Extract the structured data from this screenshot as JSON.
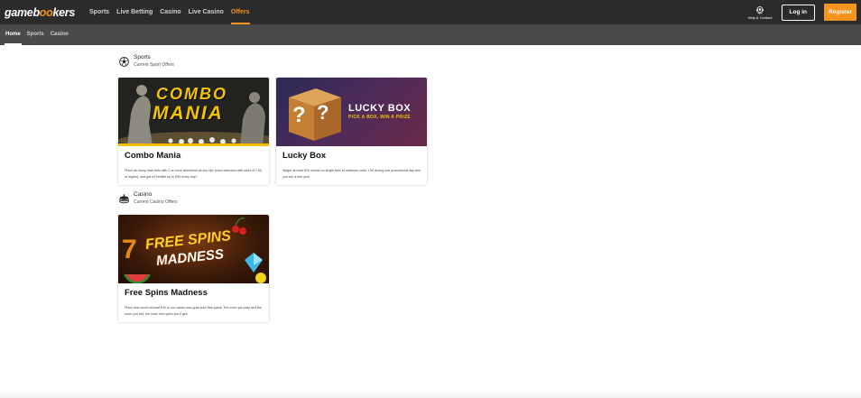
{
  "header": {
    "logo_prefix": "gameb",
    "logo_accent": "oo",
    "logo_suffix": "kers",
    "nav": [
      {
        "label": "Sports",
        "active": false
      },
      {
        "label": "Live Betting",
        "active": false
      },
      {
        "label": "Casino",
        "active": false
      },
      {
        "label": "Live Casino",
        "active": false
      },
      {
        "label": "Offers",
        "active": true
      }
    ],
    "help_label": "Help & Contact",
    "help_icon": "headset-icon",
    "login_label": "Log in",
    "register_label": "Register"
  },
  "subnav": [
    {
      "label": "Home",
      "active": true
    },
    {
      "label": "Sports",
      "active": false
    },
    {
      "label": "Casino",
      "active": false
    }
  ],
  "sections": {
    "sports": {
      "title": "Sports",
      "subtitle": "Current Sport Offers",
      "icon": "soccer-ball-icon",
      "cards": [
        {
          "title": "Combo Mania",
          "banner_line1": "COMBO",
          "banner_line2": "MANIA",
          "description": "Place as many multi bets with 2 or more selections as you like (each selection with odds of 1.50 or higher), and get a FreeBet up to €50 every day!"
        },
        {
          "title": "Lucky Box",
          "banner_line1": "LUCKY BOX",
          "banner_line2": "PICK A BOX, WIN A PRIZE",
          "banner_glyph": "?",
          "description": "Wager at least €10 overall on single bets at minimum odds 1.50 during one promotional day and you win a free pick."
        }
      ]
    },
    "casino": {
      "title": "Casino",
      "subtitle": "Current Casino Offers",
      "icon": "casino-chips-icon",
      "cards": [
        {
          "title": "Free Spins Madness",
          "banner_line1": "FREE SPINS",
          "banner_line2": "MADNESS",
          "description": "Place bets worth at least €10 in our casino and grab your free spins! The more you play and the more you bet, the more free spins you'll get!"
        }
      ]
    }
  },
  "colors": {
    "accent": "#f7941d",
    "topbar": "#2b2b2b",
    "subbar": "#4a4a4a"
  }
}
